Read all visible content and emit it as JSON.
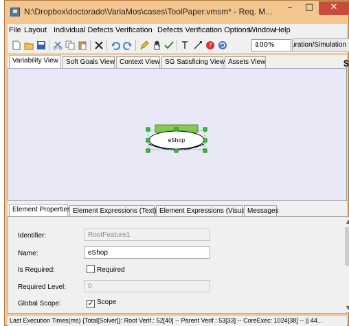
{
  "window": {
    "title": "N:\\Dropbox\\doctorado\\VariaMos\\cases\\ToolPaper.vmsm* - Req. M...",
    "minimize_glyph": "–",
    "maximize_glyph": "□",
    "close_glyph": "✕"
  },
  "menu": {
    "items": [
      {
        "label": "File"
      },
      {
        "label": "Layout"
      },
      {
        "label": "Individual Defects Verification"
      },
      {
        "label": "Defects Verification Options"
      },
      {
        "label": "Window"
      },
      {
        "label": "Help"
      }
    ]
  },
  "toolbar": {
    "zoom_value": "100%",
    "zoom_arrow": "v",
    "simulation_label": "Configuration/Simulation"
  },
  "view_tabs": [
    {
      "label": "Variability View",
      "active": true
    },
    {
      "label": "Soft Goals View"
    },
    {
      "label": "Context View"
    },
    {
      "label": "SG Satisficing View"
    },
    {
      "label": "Assets View"
    }
  ],
  "canvas": {
    "feature_label": "eShop",
    "canvas_bg": "#e8e8f6",
    "feature_bar_color": "#8cc850",
    "handle_color": "#3cc83c"
  },
  "property_tabs": [
    {
      "label": "Element Properties",
      "active": true
    },
    {
      "label": "Element Expressions (Text)"
    },
    {
      "label": "Element Expressions (Visual)"
    },
    {
      "label": "Messages"
    }
  ],
  "properties": {
    "identifier": {
      "label": "Identifier:",
      "value": "RootFeature1"
    },
    "name": {
      "label": "Name:",
      "value": "eShop"
    },
    "is_required": {
      "label": "Is Required:",
      "checkbox_label": "Required",
      "checked": false
    },
    "required_level": {
      "label": "Required Level:",
      "value": "0"
    },
    "global_scope": {
      "label": "Global Scope:",
      "checkbox_label": "Scope",
      "checked": true,
      "check_glyph": "✓"
    }
  },
  "status_bar": {
    "text": "Last Execution Times(ms) {Total[Solver]}: Root Verif.: 52[40] -- Parent Verif.: 53[33] -- CoreExec: 1024[38] -- || 44..."
  },
  "edge_glyph": "$",
  "scroll": {
    "up": "▲",
    "down": "▼"
  }
}
